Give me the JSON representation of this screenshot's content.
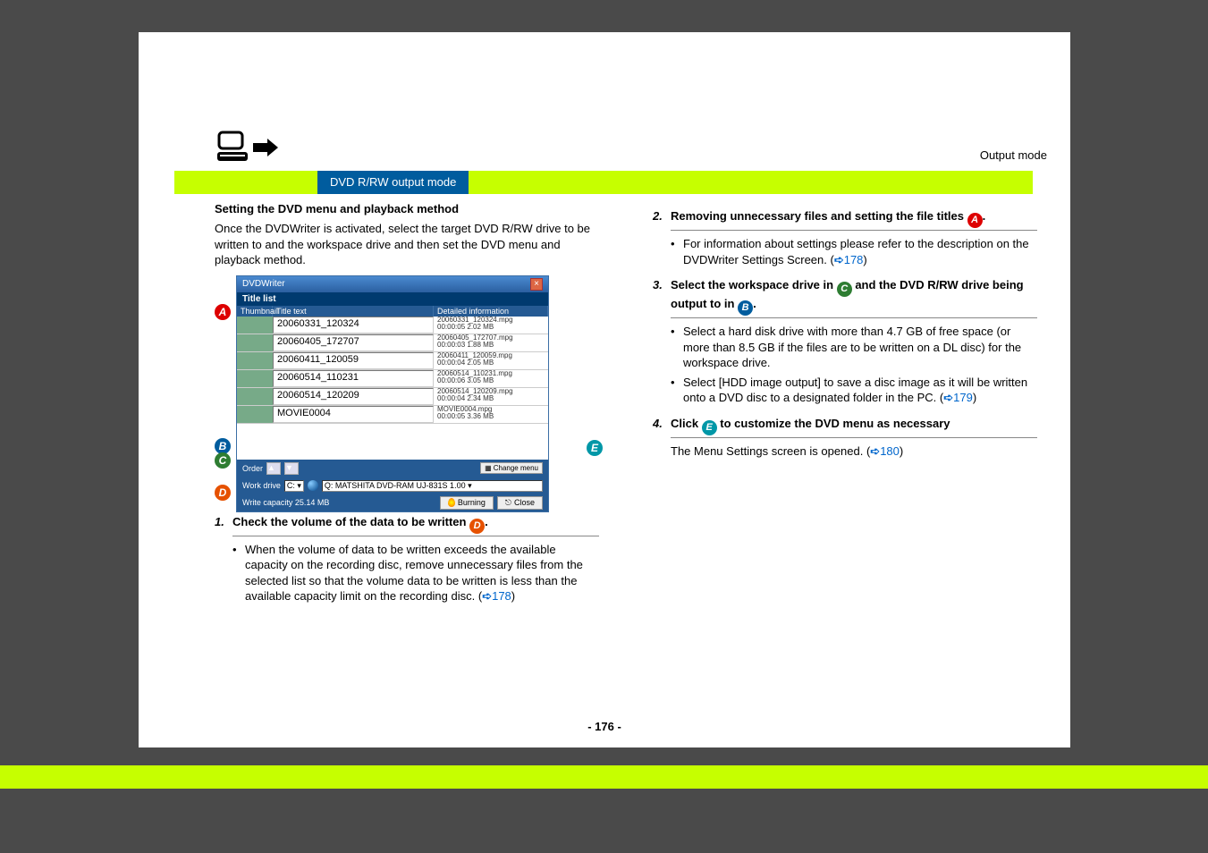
{
  "header": {
    "output_mode": "Output mode",
    "tab": "DVD R/RW output mode"
  },
  "left": {
    "h4": "Setting the DVD menu and playback method",
    "intro": "Once the DVDWriter is activated, select the target DVD R/RW drive to be written to and the workspace drive and then set the DVD menu and playback method.",
    "step1_num": "1.",
    "step1": "Check the volume of the data to be written ",
    "step1_end": ".",
    "step1_bullet": "When the volume of data to be written exceeds the available capacity on the recording disc, remove unnecessary files from the selected list so that the volume data to be written is less than the available capacity limit on the recording disc. (",
    "step1_link": "178",
    "step1_bullet_end": ")"
  },
  "win": {
    "title": "DVDWriter",
    "title_list": "Title list",
    "col_thumb": "Thumbnail",
    "col_title": "Title text",
    "col_detail": "Detailed information",
    "rows": [
      {
        "t": "20060331_120324",
        "d1": "20060331_120324.mpg",
        "d2": "00:00:05 2.02 MB"
      },
      {
        "t": "20060405_172707",
        "d1": "20060405_172707.mpg",
        "d2": "00:00:03 1.88 MB"
      },
      {
        "t": "20060411_120059",
        "d1": "20060411_120059.mpg",
        "d2": "00:00:04 2.05 MB"
      },
      {
        "t": "20060514_110231",
        "d1": "20060514_110231.mpg",
        "d2": "00:00:06 3.05 MB"
      },
      {
        "t": "20060514_120209",
        "d1": "20060514_120209.mpg",
        "d2": "00:00:04 2.34 MB"
      },
      {
        "t": "MOVIE0004",
        "d1": "MOVIE0004.mpg",
        "d2": "00:00:05 3.36 MB"
      }
    ],
    "order": "Order",
    "change_menu": "Change menu",
    "work_drive": "Work drive",
    "work_drive_val": "C:",
    "dvd_drive": "Q: MATSHITA DVD-RAM UJ-831S 1.00",
    "capacity": "Write capacity 25.14 MB",
    "burning": "Burning",
    "close": "Close"
  },
  "right": {
    "step2_num": "2.",
    "step2a": "Removing unnecessary files and setting the file titles ",
    "step2b": ".",
    "step2_bullet": "For information about settings please refer to the description on the DVDWriter Settings Screen. (",
    "step2_link": "178",
    "step2_bullet_end": ")",
    "step3_num": "3.",
    "step3a": "Select the workspace drive in ",
    "step3b": " and the DVD R/RW drive being output to in ",
    "step3c": ".",
    "step3_b1": "Select a hard disk drive with more than 4.7 GB of free space (or more than 8.5 GB if the files are to be written on a DL disc) for the workspace drive.",
    "step3_b2a": "Select [HDD image output] to save a disc image as it will be written onto a DVD disc to a designated folder in the PC. (",
    "step3_b2_link": "179",
    "step3_b2b": ")",
    "step4_num": "4.",
    "step4a": "Click ",
    "step4b": " to customize the DVD menu as necessary",
    "step4_p": "The Menu Settings screen is opened. (",
    "step4_link": "180",
    "step4_p_end": ")"
  },
  "markers": {
    "A": "A",
    "B": "B",
    "C": "C",
    "D": "D",
    "E": "E"
  },
  "page_num": "- 176 -"
}
